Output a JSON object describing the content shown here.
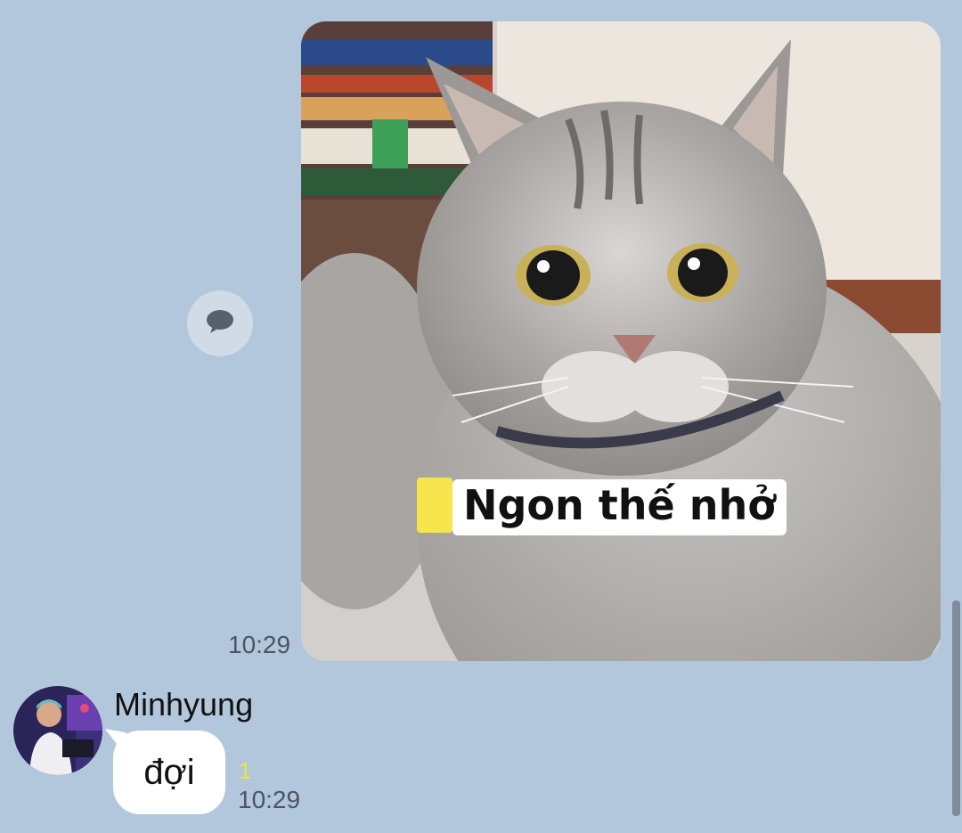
{
  "chat": {
    "sent": {
      "image_caption": "Ngon thế nhở",
      "time": "10:29"
    },
    "received": {
      "sender_name": "Minhyung",
      "message_text": "đợi",
      "unread_count": "1",
      "time": "10:29"
    }
  },
  "icons": {
    "share": "speech-bubble-icon"
  },
  "colors": {
    "background": "#b3c7dc",
    "bubble": "#ffffff",
    "unread": "#f3e23b"
  }
}
